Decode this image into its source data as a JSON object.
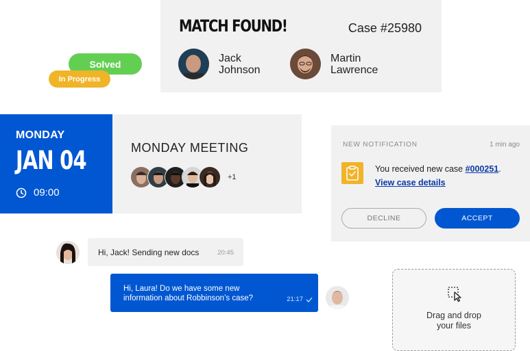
{
  "match": {
    "title": "MATCH FOUND!",
    "case_label": "Case #25980",
    "person1": {
      "first": "Jack",
      "last": "Johnson"
    },
    "person2": {
      "first": "Martin",
      "last": "Lawrence"
    }
  },
  "badges": {
    "solved": "Solved",
    "in_progress": "In Progress"
  },
  "calendar": {
    "weekday": "MONDAY",
    "date": "JAN 04",
    "time": "09:00",
    "meeting_title": "MONDAY MEETING",
    "extra_attendees": "+1"
  },
  "notification": {
    "header": "NEW NOTIFICATION",
    "time": "1 min ago",
    "text_prefix": "You received new case ",
    "case_link": "#000251",
    "text_suffix": ".",
    "details_link": "View case details",
    "decline_label": "DECLINE",
    "accept_label": "ACCEPT"
  },
  "chat": {
    "incoming": {
      "text": "Hi, Jack! Sending new docs",
      "time": "20:45"
    },
    "outgoing": {
      "line1": "Hi, Laura! Do we have some new",
      "line2": "information about Robbinson’s case?",
      "time": "21:17"
    }
  },
  "dropzone": {
    "line1": "Drag and drop",
    "line2": "your files"
  },
  "colors": {
    "primary": "#0057d1",
    "success": "#63cf52",
    "warning": "#f0b429",
    "panel": "#f1f1f1"
  },
  "icons": [
    "clock-icon",
    "clipboard-check-icon",
    "checkmark-icon",
    "cursor-select-icon"
  ]
}
